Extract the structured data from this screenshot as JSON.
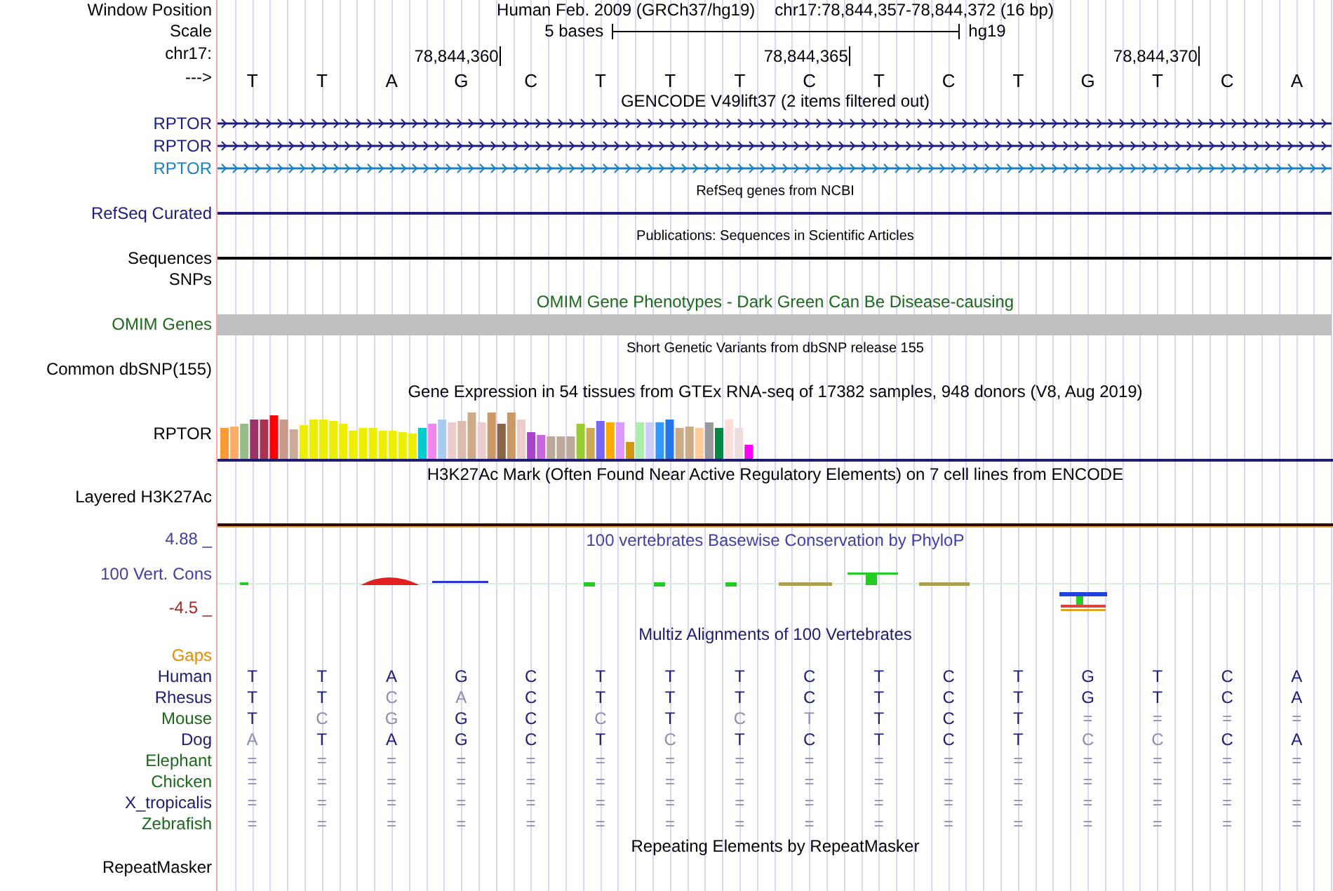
{
  "header": {
    "window_position_label": "Window Position",
    "assembly": "Human Feb. 2009 (GRCh37/hg19)",
    "position": "chr17:78,844,357-78,844,372 (16 bp)",
    "scale_label": "Scale",
    "scale_text": "5 bases",
    "scale_db": "hg19",
    "chrom_label": "chr17:",
    "strand_label": "--->"
  },
  "reference": [
    {
      "base": "T"
    },
    {
      "base": "T"
    },
    {
      "base": "A"
    },
    {
      "base": "G",
      "tick": "78,844,360"
    },
    {
      "base": "C"
    },
    {
      "base": "T"
    },
    {
      "base": "T"
    },
    {
      "base": "T"
    },
    {
      "base": "C",
      "tick": "78,844,365"
    },
    {
      "base": "T"
    },
    {
      "base": "C"
    },
    {
      "base": "T"
    },
    {
      "base": "G"
    },
    {
      "base": "T",
      "tick": "78,844,370"
    },
    {
      "base": "C"
    },
    {
      "base": "A"
    }
  ],
  "tracks": [
    {
      "kind": "title",
      "text": "GENCODE V49lift37 (2 items filtered out)",
      "color": "#000000"
    },
    {
      "kind": "gene",
      "label": "RPTOR",
      "color": "#1c1c80"
    },
    {
      "kind": "gene",
      "label": "RPTOR",
      "color": "#1c1c80"
    },
    {
      "kind": "gene",
      "label": "RPTOR",
      "color": "#1c80c0"
    },
    {
      "kind": "small_title",
      "text": "RefSeq genes from NCBI",
      "color": "#000000"
    },
    {
      "kind": "line",
      "label": "RefSeq Curated",
      "color": "#1c1c80"
    },
    {
      "kind": "small_title",
      "text": "Publications: Sequences in Scientific Articles",
      "color": "#000000"
    },
    {
      "kind": "line",
      "label": "Sequences",
      "color": "#000000"
    },
    {
      "kind": "label",
      "label": "SNPs",
      "color": "#000000"
    },
    {
      "kind": "title",
      "text": "OMIM Gene Phenotypes - Dark Green Can Be Disease-causing",
      "color": "#1a6a1a"
    },
    {
      "kind": "bar",
      "label": "OMIM Genes",
      "color": "#1a6a1a"
    },
    {
      "kind": "small_title",
      "text": "Short Genetic Variants from dbSNP release 155",
      "color": "#000000"
    },
    {
      "kind": "label",
      "label": "Common dbSNP(155)",
      "color": "#000000"
    },
    {
      "kind": "title",
      "text": "Gene Expression in 54 tissues from GTEx RNA-seq of 17382 samples, 948 donors (V8, Aug 2019)",
      "color": "#000000"
    },
    {
      "kind": "expression",
      "label": "RPTOR",
      "color": "#000000"
    },
    {
      "kind": "signal",
      "title": "H3K27Ac Mark (Often Found Near Active Regulatory Elements) on 7 cell lines from ENCODE",
      "label": "Layered H3K27Ac",
      "color": "#000000"
    },
    {
      "kind": "conservation",
      "title": "100 vertebrates Basewise Conservation by PhyloP",
      "label": "100 Vert. Cons",
      "max": "4.88 _",
      "min": "-4.5 _",
      "color": "#4040a0"
    },
    {
      "kind": "title",
      "text": "Multiz Alignments of 100 Vertebrates",
      "color": "#1c1c70"
    },
    {
      "kind": "label",
      "label": "Gaps",
      "color": "#e88a00"
    },
    {
      "kind": "alignment",
      "species": [
        {
          "name": "Human",
          "color": "#1c1c70",
          "bases": [
            {
              "base": "T",
              "match": true
            },
            {
              "base": "T",
              "match": true
            },
            {
              "base": "A",
              "match": true
            },
            {
              "base": "G",
              "match": true
            },
            {
              "base": "C",
              "match": true
            },
            {
              "base": "T",
              "match": true
            },
            {
              "base": "T",
              "match": true
            },
            {
              "base": "T",
              "match": true
            },
            {
              "base": "C",
              "match": true
            },
            {
              "base": "T",
              "match": true
            },
            {
              "base": "C",
              "match": true
            },
            {
              "base": "T",
              "match": true
            },
            {
              "base": "G",
              "match": true
            },
            {
              "base": "T",
              "match": true
            },
            {
              "base": "C",
              "match": true
            },
            {
              "base": "A",
              "match": true
            }
          ]
        },
        {
          "name": "Rhesus",
          "color": "#1c1c70",
          "bases": [
            {
              "base": "T",
              "match": true
            },
            {
              "base": "T",
              "match": true
            },
            {
              "base": "C",
              "match": false
            },
            {
              "base": "A",
              "match": false
            },
            {
              "base": "C",
              "match": true
            },
            {
              "base": "T",
              "match": true
            },
            {
              "base": "T",
              "match": true
            },
            {
              "base": "T",
              "match": true
            },
            {
              "base": "C",
              "match": true
            },
            {
              "base": "T",
              "match": true
            },
            {
              "base": "C",
              "match": true
            },
            {
              "base": "T",
              "match": true
            },
            {
              "base": "G",
              "match": true
            },
            {
              "base": "T",
              "match": true
            },
            {
              "base": "C",
              "match": true
            },
            {
              "base": "A",
              "match": true
            }
          ]
        },
        {
          "name": "Mouse",
          "color": "#1a6a1a",
          "bases": [
            {
              "base": "T",
              "match": true
            },
            {
              "base": "C",
              "match": false
            },
            {
              "base": "G",
              "match": false
            },
            {
              "base": "G",
              "match": true
            },
            {
              "base": "C",
              "match": true
            },
            {
              "base": "C",
              "match": false
            },
            {
              "base": "T",
              "match": true
            },
            {
              "base": "C",
              "match": false
            },
            {
              "base": "T",
              "match": false
            },
            {
              "base": "T",
              "match": true
            },
            {
              "base": "C",
              "match": true
            },
            {
              "base": "T",
              "match": true
            },
            {
              "base": "=",
              "match": false
            },
            {
              "base": "=",
              "match": false
            },
            {
              "base": "=",
              "match": false
            },
            {
              "base": "=",
              "match": false
            }
          ]
        },
        {
          "name": "Dog",
          "color": "#1c1c70",
          "bases": [
            {
              "base": "A",
              "match": false
            },
            {
              "base": "T",
              "match": true
            },
            {
              "base": "A",
              "match": true
            },
            {
              "base": "G",
              "match": true
            },
            {
              "base": "C",
              "match": true
            },
            {
              "base": "T",
              "match": true
            },
            {
              "base": "C",
              "match": false
            },
            {
              "base": "T",
              "match": true
            },
            {
              "base": "C",
              "match": true
            },
            {
              "base": "T",
              "match": true
            },
            {
              "base": "C",
              "match": true
            },
            {
              "base": "T",
              "match": true
            },
            {
              "base": "C",
              "match": false
            },
            {
              "base": "C",
              "match": false
            },
            {
              "base": "C",
              "match": true
            },
            {
              "base": "A",
              "match": true
            }
          ]
        },
        {
          "name": "Elephant",
          "color": "#1a6a1a",
          "bases": [
            {
              "base": "=",
              "match": false
            },
            {
              "base": "=",
              "match": false
            },
            {
              "base": "=",
              "match": false
            },
            {
              "base": "=",
              "match": false
            },
            {
              "base": "=",
              "match": false
            },
            {
              "base": "=",
              "match": false
            },
            {
              "base": "=",
              "match": false
            },
            {
              "base": "=",
              "match": false
            },
            {
              "base": "=",
              "match": false
            },
            {
              "base": "=",
              "match": false
            },
            {
              "base": "=",
              "match": false
            },
            {
              "base": "=",
              "match": false
            },
            {
              "base": "=",
              "match": false
            },
            {
              "base": "=",
              "match": false
            },
            {
              "base": "=",
              "match": false
            },
            {
              "base": "=",
              "match": false
            }
          ]
        },
        {
          "name": "Chicken",
          "color": "#1a6a1a",
          "bases": [
            {
              "base": "=",
              "match": false
            },
            {
              "base": "=",
              "match": false
            },
            {
              "base": "=",
              "match": false
            },
            {
              "base": "=",
              "match": false
            },
            {
              "base": "=",
              "match": false
            },
            {
              "base": "=",
              "match": false
            },
            {
              "base": "=",
              "match": false
            },
            {
              "base": "=",
              "match": false
            },
            {
              "base": "=",
              "match": false
            },
            {
              "base": "=",
              "match": false
            },
            {
              "base": "=",
              "match": false
            },
            {
              "base": "=",
              "match": false
            },
            {
              "base": "=",
              "match": false
            },
            {
              "base": "=",
              "match": false
            },
            {
              "base": "=",
              "match": false
            },
            {
              "base": "=",
              "match": false
            }
          ]
        },
        {
          "name": "X_tropicalis",
          "color": "#1c1c70",
          "bases": [
            {
              "base": "=",
              "match": false
            },
            {
              "base": "=",
              "match": false
            },
            {
              "base": "=",
              "match": false
            },
            {
              "base": "=",
              "match": false
            },
            {
              "base": "=",
              "match": false
            },
            {
              "base": "=",
              "match": false
            },
            {
              "base": "=",
              "match": false
            },
            {
              "base": "=",
              "match": false
            },
            {
              "base": "=",
              "match": false
            },
            {
              "base": "=",
              "match": false
            },
            {
              "base": "=",
              "match": false
            },
            {
              "base": "=",
              "match": false
            },
            {
              "base": "=",
              "match": false
            },
            {
              "base": "=",
              "match": false
            },
            {
              "base": "=",
              "match": false
            },
            {
              "base": "=",
              "match": false
            }
          ]
        },
        {
          "name": "Zebrafish",
          "color": "#1a6a1a",
          "bases": [
            {
              "base": "=",
              "match": false
            },
            {
              "base": "=",
              "match": false
            },
            {
              "base": "=",
              "match": false
            },
            {
              "base": "=",
              "match": false
            },
            {
              "base": "=",
              "match": false
            },
            {
              "base": "=",
              "match": false
            },
            {
              "base": "=",
              "match": false
            },
            {
              "base": "=",
              "match": false
            },
            {
              "base": "=",
              "match": false
            },
            {
              "base": "=",
              "match": false
            },
            {
              "base": "=",
              "match": false
            },
            {
              "base": "=",
              "match": false
            },
            {
              "base": "=",
              "match": false
            },
            {
              "base": "=",
              "match": false
            },
            {
              "base": "=",
              "match": false
            },
            {
              "base": "=",
              "match": false
            }
          ]
        }
      ]
    },
    {
      "kind": "title",
      "text": "Repeating Elements by RepeatMasker",
      "color": "#000000"
    },
    {
      "kind": "label",
      "label": "RepeatMasker",
      "color": "#000000"
    }
  ]
}
